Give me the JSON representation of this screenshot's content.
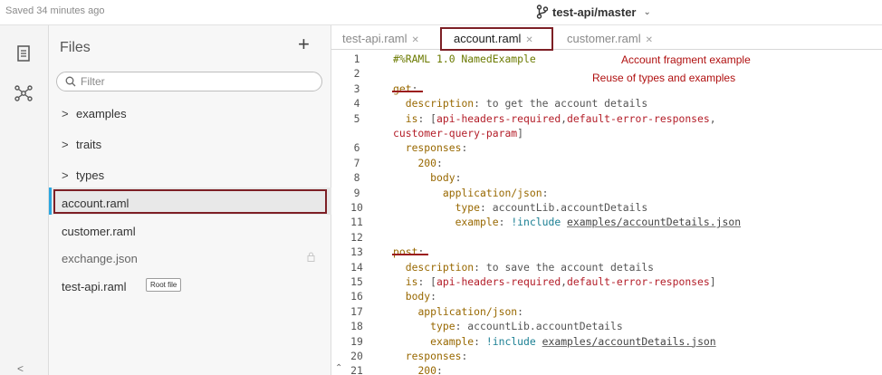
{
  "topbar": {
    "saved_text": "Saved 34 minutes ago",
    "branch": "test-api/master"
  },
  "files_panel": {
    "title": "Files",
    "add_label": "+",
    "filter_placeholder": "Filter",
    "folders": [
      {
        "label": "examples"
      },
      {
        "label": "traits"
      },
      {
        "label": "types"
      }
    ],
    "files": [
      {
        "label": "account.raml",
        "selected": true
      },
      {
        "label": "customer.raml"
      },
      {
        "label": "exchange.json",
        "locked": true
      },
      {
        "label": "test-api.raml",
        "badge": "Root file"
      }
    ],
    "collapse_label": "<"
  },
  "editor": {
    "tabs": [
      {
        "label": "test-api.raml"
      },
      {
        "label": "account.raml",
        "active": true
      },
      {
        "label": "customer.raml"
      }
    ],
    "annotations": {
      "line1": "Account fragment example",
      "line2": "Reuse of types and examples"
    },
    "lines": [
      {
        "n": "1",
        "parts": [
          [
            "cm",
            "#%RAML 1.0 NamedExample"
          ]
        ]
      },
      {
        "n": "2",
        "parts": []
      },
      {
        "n": "3",
        "parts": [
          [
            "k",
            "get"
          ],
          [
            "p",
            ":"
          ]
        ]
      },
      {
        "n": "4",
        "parts": [
          [
            "p",
            "  "
          ],
          [
            "k",
            "description"
          ],
          [
            "p",
            ": to get the account details"
          ]
        ]
      },
      {
        "n": "5",
        "parts": [
          [
            "p",
            "  "
          ],
          [
            "k",
            "is"
          ],
          [
            "p",
            ": ["
          ],
          [
            "s",
            "api-headers-required"
          ],
          [
            "p",
            ","
          ],
          [
            "s",
            "default-error-responses"
          ],
          [
            "p",
            ","
          ]
        ]
      },
      {
        "n": "",
        "parts": [
          [
            "s",
            "customer-query-param"
          ],
          [
            "p",
            "]"
          ]
        ]
      },
      {
        "n": "6",
        "parts": [
          [
            "p",
            "  "
          ],
          [
            "k",
            "responses"
          ],
          [
            "p",
            ":"
          ]
        ]
      },
      {
        "n": "7",
        "parts": [
          [
            "p",
            "    "
          ],
          [
            "k",
            "200"
          ],
          [
            "p",
            ":"
          ]
        ]
      },
      {
        "n": "8",
        "parts": [
          [
            "p",
            "      "
          ],
          [
            "k",
            "body"
          ],
          [
            "p",
            ":"
          ]
        ]
      },
      {
        "n": "9",
        "parts": [
          [
            "p",
            "        "
          ],
          [
            "k",
            "application/json"
          ],
          [
            "p",
            ":"
          ]
        ]
      },
      {
        "n": "10",
        "parts": [
          [
            "p",
            "          "
          ],
          [
            "k",
            "type"
          ],
          [
            "p",
            ": accountLib.accountDetails"
          ]
        ]
      },
      {
        "n": "11",
        "parts": [
          [
            "p",
            "          "
          ],
          [
            "k",
            "example"
          ],
          [
            "p",
            ": "
          ],
          [
            "kw",
            "!include"
          ],
          [
            "p",
            " "
          ],
          [
            "u",
            "examples/accountDetails.json"
          ]
        ]
      },
      {
        "n": "12",
        "parts": []
      },
      {
        "n": "13",
        "parts": [
          [
            "k",
            "post"
          ],
          [
            "p",
            ":"
          ]
        ]
      },
      {
        "n": "14",
        "parts": [
          [
            "p",
            "  "
          ],
          [
            "k",
            "description"
          ],
          [
            "p",
            ": to save the account details"
          ]
        ]
      },
      {
        "n": "15",
        "parts": [
          [
            "p",
            "  "
          ],
          [
            "k",
            "is"
          ],
          [
            "p",
            ": ["
          ],
          [
            "s",
            "api-headers-required"
          ],
          [
            "p",
            ","
          ],
          [
            "s",
            "default-error-responses"
          ],
          [
            "p",
            "]"
          ]
        ]
      },
      {
        "n": "16",
        "parts": [
          [
            "p",
            "  "
          ],
          [
            "k",
            "body"
          ],
          [
            "p",
            ":"
          ]
        ]
      },
      {
        "n": "17",
        "parts": [
          [
            "p",
            "    "
          ],
          [
            "k",
            "application/json"
          ],
          [
            "p",
            ":"
          ]
        ]
      },
      {
        "n": "18",
        "parts": [
          [
            "p",
            "      "
          ],
          [
            "k",
            "type"
          ],
          [
            "p",
            ": accountLib.accountDetails"
          ]
        ]
      },
      {
        "n": "19",
        "parts": [
          [
            "p",
            "      "
          ],
          [
            "k",
            "example"
          ],
          [
            "p",
            ": "
          ],
          [
            "kw",
            "!include"
          ],
          [
            "p",
            " "
          ],
          [
            "u",
            "examples/accountDetails.json"
          ]
        ]
      },
      {
        "n": "20",
        "parts": [
          [
            "p",
            "  "
          ],
          [
            "k",
            "responses"
          ],
          [
            "p",
            ":"
          ]
        ]
      },
      {
        "n": "21",
        "parts": [
          [
            "p",
            "    "
          ],
          [
            "k",
            "200"
          ],
          [
            "p",
            ":"
          ]
        ]
      }
    ]
  },
  "colors": {
    "selection_accent": "#2aa6e0",
    "highlight_box": "#7d1f25",
    "annotation_text": "#b01010"
  }
}
